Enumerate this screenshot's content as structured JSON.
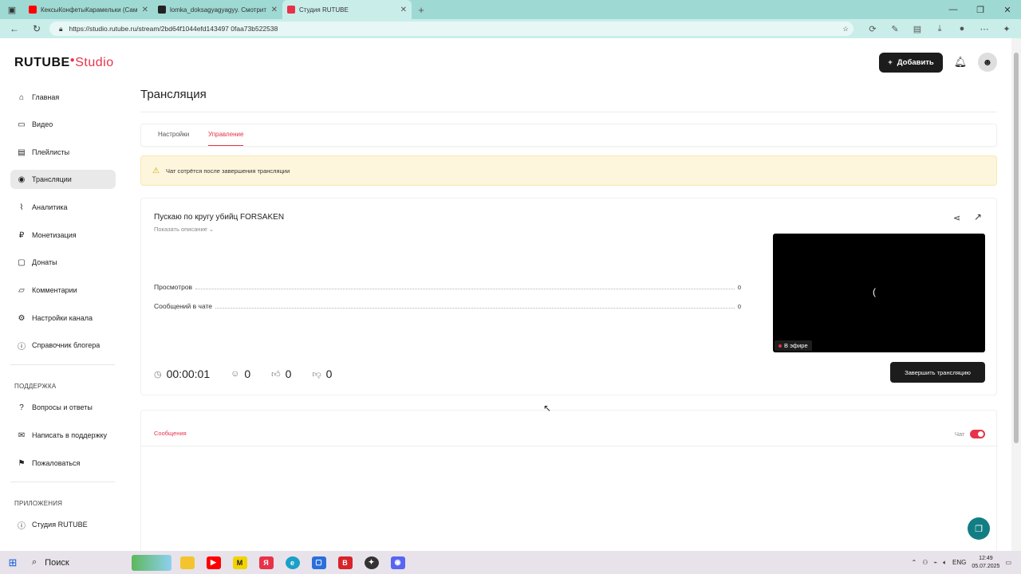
{
  "browser": {
    "tabs": [
      {
        "title": "КексыКонфетыКарамельки (Сам",
        "favicon_color": "#ff0000"
      },
      {
        "title": "lomka_doksagyagyagyy. Смотрит",
        "favicon_color": "#222222"
      },
      {
        "title": "Студия RUTUBE",
        "favicon_color": "#e8324a",
        "active": true
      }
    ],
    "url": "https://studio.rutube.ru/stream/2bd64f1044efd143497 0faa73b522538"
  },
  "header": {
    "logo_main": "RUTUBE",
    "logo_sub": "Studio",
    "add_button": "Добавить"
  },
  "sidebar": {
    "items": [
      {
        "label": "Главная",
        "icon": "home-icon"
      },
      {
        "label": "Видео",
        "icon": "video-icon"
      },
      {
        "label": "Плейлисты",
        "icon": "playlist-icon"
      },
      {
        "label": "Трансляции",
        "icon": "broadcast-icon",
        "active": true
      },
      {
        "label": "Аналитика",
        "icon": "analytics-icon"
      },
      {
        "label": "Монетизация",
        "icon": "ruble-icon"
      },
      {
        "label": "Донаты",
        "icon": "donate-icon"
      },
      {
        "label": "Комментарии",
        "icon": "comment-icon"
      },
      {
        "label": "Настройки канала",
        "icon": "gear-icon"
      },
      {
        "label": "Справочник блогера",
        "icon": "info-icon"
      }
    ],
    "support_heading": "ПОДДЕРЖКА",
    "support_items": [
      {
        "label": "Вопросы и ответы",
        "icon": "question-icon"
      },
      {
        "label": "Написать в поддержку",
        "icon": "mail-icon"
      },
      {
        "label": "Пожаловаться",
        "icon": "flag-icon"
      }
    ],
    "apps_heading": "ПРИЛОЖЕНИЯ",
    "apps_items": [
      {
        "label": "Студия RUTUBE",
        "icon": "info-icon"
      }
    ]
  },
  "page": {
    "title": "Трансляция",
    "tabs": [
      "Настройки",
      "Управление"
    ],
    "active_tab": "Управление",
    "warning": "Чат сотрётся после завершения трансляции"
  },
  "stream": {
    "title": "Пускаю по кругу убийц FORSAKEN",
    "show_description": "Показать описание",
    "stats": [
      {
        "label": "Просмотров",
        "value": "0"
      },
      {
        "label": "Сообщений в чате",
        "value": "0"
      }
    ],
    "duration": "00:00:01",
    "viewers": "0",
    "likes": "0",
    "dislikes": "0",
    "live_badge": "В эфире",
    "end_button": "Завершить трансляцию"
  },
  "chat": {
    "messages_tab": "Сообщения",
    "chat_label": "Чат",
    "chat_enabled": true
  },
  "taskbar": {
    "search_label": "Поиск",
    "lang": "ENG",
    "time": "12:49",
    "date": "05.07.2025"
  },
  "colors": {
    "accent": "#e8324a",
    "dark_button": "#1c1c1c",
    "browser_chrome": "#9fd9d3",
    "warning_bg": "#fdf6dc"
  }
}
